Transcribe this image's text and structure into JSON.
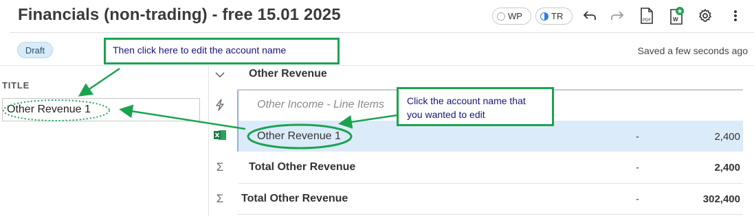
{
  "header": {
    "title": "Financials (non-trading) - free 15.01 2025",
    "badges": [
      {
        "label": "WP"
      },
      {
        "label": "TR"
      }
    ],
    "icons": [
      "undo-icon",
      "redo-icon",
      "pdf-icon",
      "word-export-icon",
      "settings-icon",
      "more-vert-icon"
    ]
  },
  "status": {
    "draft_label": "Draft",
    "saved_text": "Saved a few seconds ago"
  },
  "left_panel": {
    "section_label": "TITLE",
    "title_value": "Other Revenue 1"
  },
  "table": {
    "section_header": "Other Revenue",
    "rows": [
      {
        "label": "Other Income - Line Items",
        "style": "italic"
      },
      {
        "label": "Other Revenue 1",
        "prior": "-",
        "current": "2,400",
        "selected": true
      },
      {
        "label": "Total Other Revenue",
        "prior": "-",
        "current": "2,400",
        "style": "bold"
      },
      {
        "label": "Total Other Revenue",
        "prior": "-",
        "current": "302,400",
        "style": "bold"
      }
    ]
  },
  "annotations": {
    "callout_top": "Then click here to edit the account name",
    "callout_right_line1": "Click the account name that",
    "callout_right_line2": "you wanted to edit",
    "highlight_color": "#1aa34f"
  },
  "colors": {
    "selected_row": "#dcebf9",
    "draft_badge": "#d9ebf7",
    "accent_blue": "#2f7ed8",
    "excel_green": "#1d7a45"
  }
}
